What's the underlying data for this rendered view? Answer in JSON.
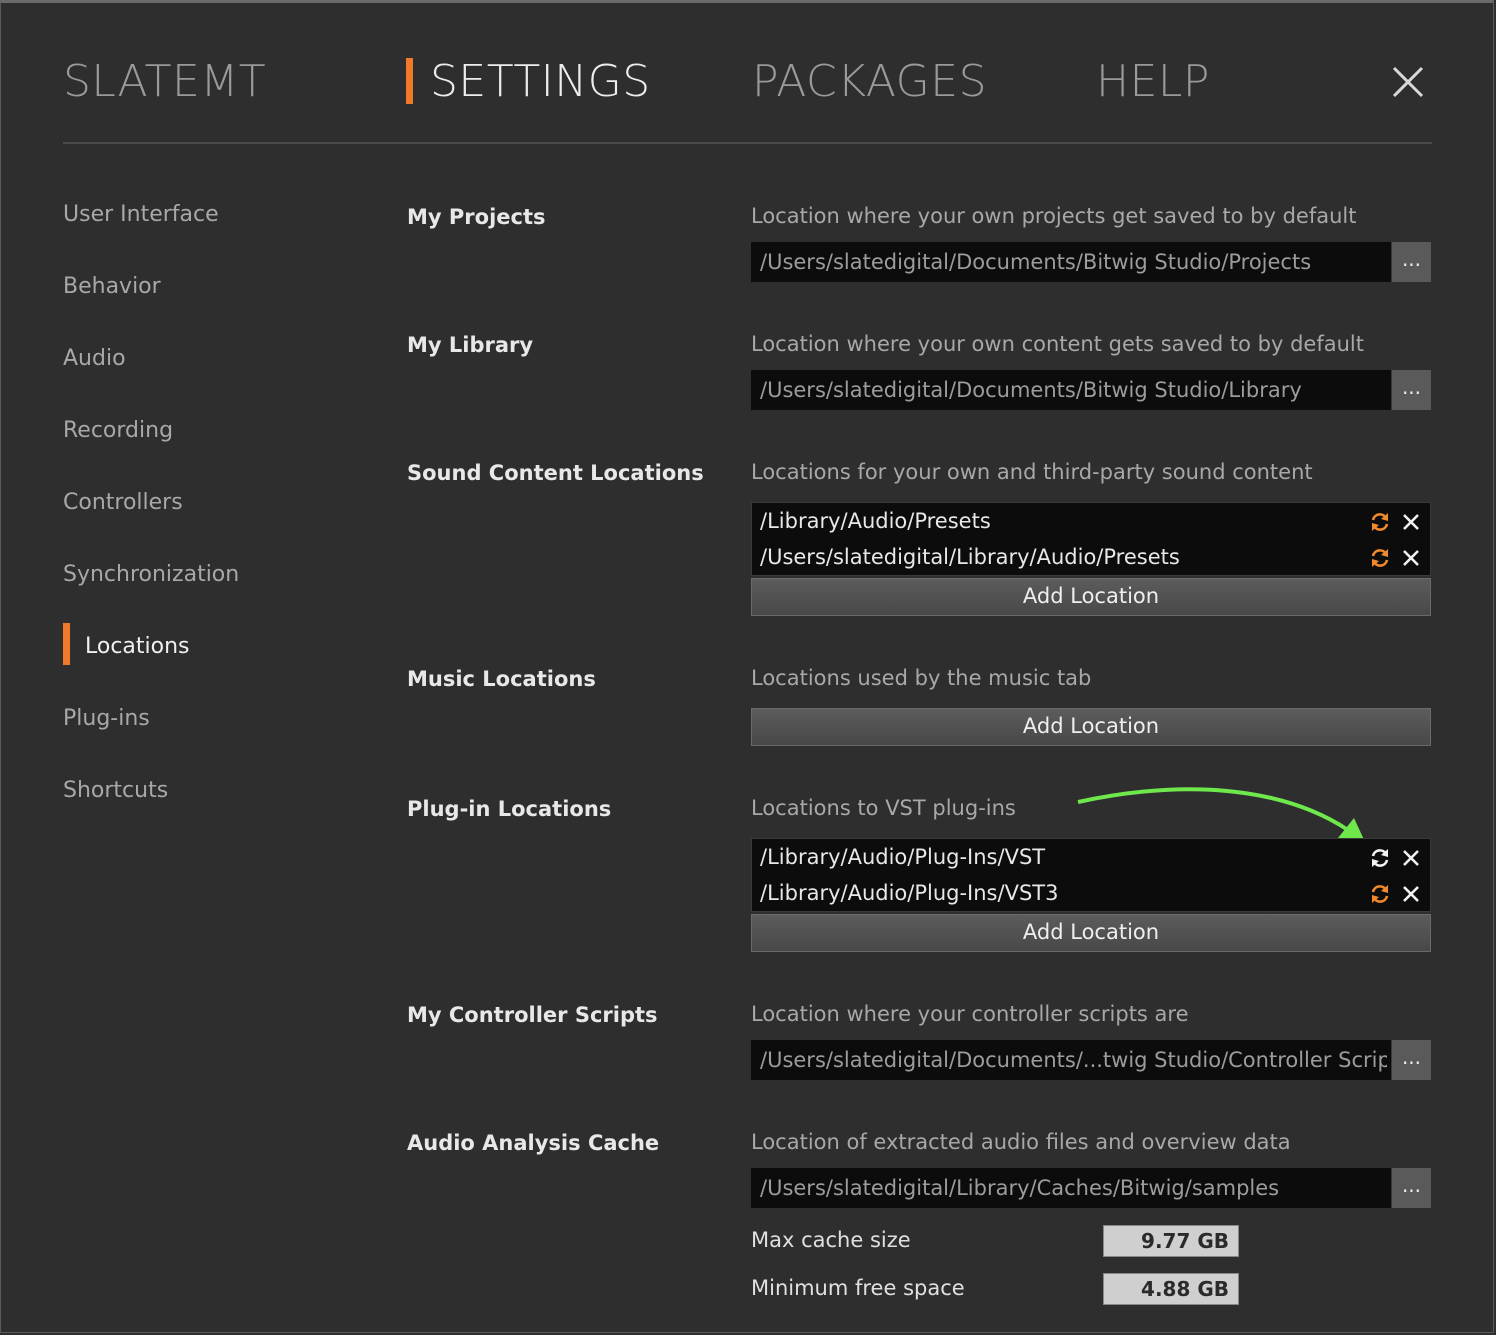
{
  "nav": {
    "tabs": [
      "SLATEMT",
      "SETTINGS",
      "PACKAGES",
      "HELP"
    ],
    "active_tab": "SETTINGS",
    "close_icon": "close-icon"
  },
  "sidebar": {
    "items": [
      "User Interface",
      "Behavior",
      "Audio",
      "Recording",
      "Controllers",
      "Synchronization",
      "Locations",
      "Plug-ins",
      "Shortcuts"
    ],
    "active": "Locations"
  },
  "sections": {
    "my_projects": {
      "title": "My Projects",
      "desc": "Location where your own projects get saved to by default",
      "path": "/Users/slatedigital/Documents/Bitwig Studio/Projects",
      "browse": "..."
    },
    "my_library": {
      "title": "My Library",
      "desc": "Location where your own content gets saved to by default",
      "path": "/Users/slatedigital/Documents/Bitwig Studio/Library",
      "browse": "..."
    },
    "sound_content": {
      "title": "Sound Content Locations",
      "desc": "Locations for your own and third-party sound content",
      "paths": [
        "/Library/Audio/Presets",
        "/Users/slatedigital/Library/Audio/Presets"
      ],
      "add": "Add Location"
    },
    "music": {
      "title": "Music Locations",
      "desc": "Locations used by the music tab",
      "add": "Add Location"
    },
    "plugin": {
      "title": "Plug-in Locations",
      "desc": "Locations to VST plug-ins",
      "paths": [
        "/Library/Audio/Plug-Ins/VST",
        "/Library/Audio/Plug-Ins/VST3"
      ],
      "add": "Add Location"
    },
    "controller_scripts": {
      "title": "My Controller Scripts",
      "desc": "Location where your controller scripts are",
      "path": "/Users/slatedigital/Documents/...twig Studio/Controller Scripts",
      "browse": "..."
    },
    "audio_cache": {
      "title": "Audio Analysis Cache",
      "desc": "Location of extracted audio files and overview data",
      "path": "/Users/slatedigital/Library/Caches/Bitwig/samples",
      "browse": "...",
      "max_label": "Max cache size",
      "max_value": "9.77 GB",
      "min_label": "Minimum free space",
      "min_value": "4.88 GB"
    }
  },
  "colors": {
    "accent": "#f07a2a",
    "annotation_arrow": "#6ee84a",
    "background": "#2e2e2e"
  }
}
